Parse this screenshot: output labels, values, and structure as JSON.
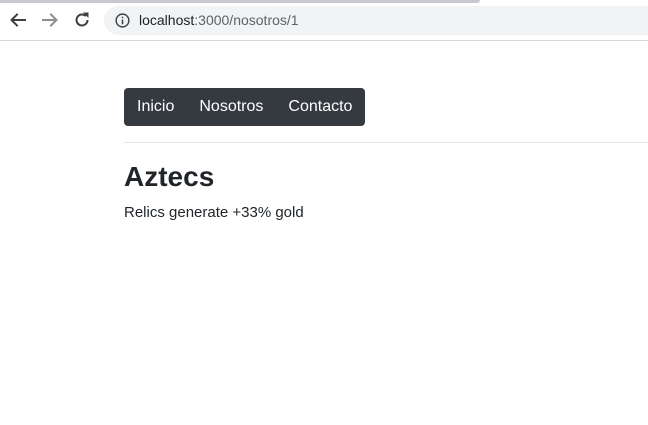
{
  "browser": {
    "url_host": "localhost",
    "url_path": ":3000/nosotros/1",
    "icons": {
      "back": "arrow-left-icon",
      "forward": "arrow-right-icon",
      "reload": "reload-icon",
      "info": "info-icon"
    }
  },
  "navbar": {
    "links": [
      {
        "label": "Inicio"
      },
      {
        "label": "Nosotros"
      },
      {
        "label": "Contacto"
      }
    ],
    "background": "#343a40"
  },
  "content": {
    "title": "Aztecs",
    "description": "Relics generate +33% gold"
  }
}
